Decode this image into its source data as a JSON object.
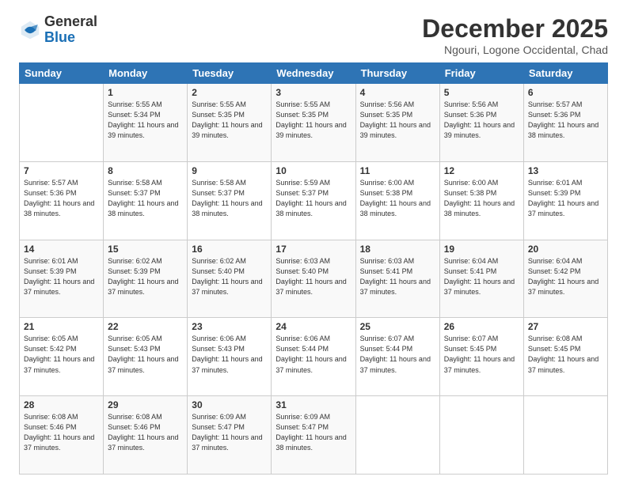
{
  "header": {
    "logo_general": "General",
    "logo_blue": "Blue",
    "main_title": "December 2025",
    "subtitle": "Ngouri, Logone Occidental, Chad"
  },
  "days_of_week": [
    "Sunday",
    "Monday",
    "Tuesday",
    "Wednesday",
    "Thursday",
    "Friday",
    "Saturday"
  ],
  "weeks": [
    [
      {
        "day": "",
        "sunrise": "",
        "sunset": "",
        "daylight": ""
      },
      {
        "day": "1",
        "sunrise": "Sunrise: 5:55 AM",
        "sunset": "Sunset: 5:34 PM",
        "daylight": "Daylight: 11 hours and 39 minutes."
      },
      {
        "day": "2",
        "sunrise": "Sunrise: 5:55 AM",
        "sunset": "Sunset: 5:35 PM",
        "daylight": "Daylight: 11 hours and 39 minutes."
      },
      {
        "day": "3",
        "sunrise": "Sunrise: 5:55 AM",
        "sunset": "Sunset: 5:35 PM",
        "daylight": "Daylight: 11 hours and 39 minutes."
      },
      {
        "day": "4",
        "sunrise": "Sunrise: 5:56 AM",
        "sunset": "Sunset: 5:35 PM",
        "daylight": "Daylight: 11 hours and 39 minutes."
      },
      {
        "day": "5",
        "sunrise": "Sunrise: 5:56 AM",
        "sunset": "Sunset: 5:36 PM",
        "daylight": "Daylight: 11 hours and 39 minutes."
      },
      {
        "day": "6",
        "sunrise": "Sunrise: 5:57 AM",
        "sunset": "Sunset: 5:36 PM",
        "daylight": "Daylight: 11 hours and 38 minutes."
      }
    ],
    [
      {
        "day": "7",
        "sunrise": "Sunrise: 5:57 AM",
        "sunset": "Sunset: 5:36 PM",
        "daylight": "Daylight: 11 hours and 38 minutes."
      },
      {
        "day": "8",
        "sunrise": "Sunrise: 5:58 AM",
        "sunset": "Sunset: 5:37 PM",
        "daylight": "Daylight: 11 hours and 38 minutes."
      },
      {
        "day": "9",
        "sunrise": "Sunrise: 5:58 AM",
        "sunset": "Sunset: 5:37 PM",
        "daylight": "Daylight: 11 hours and 38 minutes."
      },
      {
        "day": "10",
        "sunrise": "Sunrise: 5:59 AM",
        "sunset": "Sunset: 5:37 PM",
        "daylight": "Daylight: 11 hours and 38 minutes."
      },
      {
        "day": "11",
        "sunrise": "Sunrise: 6:00 AM",
        "sunset": "Sunset: 5:38 PM",
        "daylight": "Daylight: 11 hours and 38 minutes."
      },
      {
        "day": "12",
        "sunrise": "Sunrise: 6:00 AM",
        "sunset": "Sunset: 5:38 PM",
        "daylight": "Daylight: 11 hours and 38 minutes."
      },
      {
        "day": "13",
        "sunrise": "Sunrise: 6:01 AM",
        "sunset": "Sunset: 5:39 PM",
        "daylight": "Daylight: 11 hours and 37 minutes."
      }
    ],
    [
      {
        "day": "14",
        "sunrise": "Sunrise: 6:01 AM",
        "sunset": "Sunset: 5:39 PM",
        "daylight": "Daylight: 11 hours and 37 minutes."
      },
      {
        "day": "15",
        "sunrise": "Sunrise: 6:02 AM",
        "sunset": "Sunset: 5:39 PM",
        "daylight": "Daylight: 11 hours and 37 minutes."
      },
      {
        "day": "16",
        "sunrise": "Sunrise: 6:02 AM",
        "sunset": "Sunset: 5:40 PM",
        "daylight": "Daylight: 11 hours and 37 minutes."
      },
      {
        "day": "17",
        "sunrise": "Sunrise: 6:03 AM",
        "sunset": "Sunset: 5:40 PM",
        "daylight": "Daylight: 11 hours and 37 minutes."
      },
      {
        "day": "18",
        "sunrise": "Sunrise: 6:03 AM",
        "sunset": "Sunset: 5:41 PM",
        "daylight": "Daylight: 11 hours and 37 minutes."
      },
      {
        "day": "19",
        "sunrise": "Sunrise: 6:04 AM",
        "sunset": "Sunset: 5:41 PM",
        "daylight": "Daylight: 11 hours and 37 minutes."
      },
      {
        "day": "20",
        "sunrise": "Sunrise: 6:04 AM",
        "sunset": "Sunset: 5:42 PM",
        "daylight": "Daylight: 11 hours and 37 minutes."
      }
    ],
    [
      {
        "day": "21",
        "sunrise": "Sunrise: 6:05 AM",
        "sunset": "Sunset: 5:42 PM",
        "daylight": "Daylight: 11 hours and 37 minutes."
      },
      {
        "day": "22",
        "sunrise": "Sunrise: 6:05 AM",
        "sunset": "Sunset: 5:43 PM",
        "daylight": "Daylight: 11 hours and 37 minutes."
      },
      {
        "day": "23",
        "sunrise": "Sunrise: 6:06 AM",
        "sunset": "Sunset: 5:43 PM",
        "daylight": "Daylight: 11 hours and 37 minutes."
      },
      {
        "day": "24",
        "sunrise": "Sunrise: 6:06 AM",
        "sunset": "Sunset: 5:44 PM",
        "daylight": "Daylight: 11 hours and 37 minutes."
      },
      {
        "day": "25",
        "sunrise": "Sunrise: 6:07 AM",
        "sunset": "Sunset: 5:44 PM",
        "daylight": "Daylight: 11 hours and 37 minutes."
      },
      {
        "day": "26",
        "sunrise": "Sunrise: 6:07 AM",
        "sunset": "Sunset: 5:45 PM",
        "daylight": "Daylight: 11 hours and 37 minutes."
      },
      {
        "day": "27",
        "sunrise": "Sunrise: 6:08 AM",
        "sunset": "Sunset: 5:45 PM",
        "daylight": "Daylight: 11 hours and 37 minutes."
      }
    ],
    [
      {
        "day": "28",
        "sunrise": "Sunrise: 6:08 AM",
        "sunset": "Sunset: 5:46 PM",
        "daylight": "Daylight: 11 hours and 37 minutes."
      },
      {
        "day": "29",
        "sunrise": "Sunrise: 6:08 AM",
        "sunset": "Sunset: 5:46 PM",
        "daylight": "Daylight: 11 hours and 37 minutes."
      },
      {
        "day": "30",
        "sunrise": "Sunrise: 6:09 AM",
        "sunset": "Sunset: 5:47 PM",
        "daylight": "Daylight: 11 hours and 37 minutes."
      },
      {
        "day": "31",
        "sunrise": "Sunrise: 6:09 AM",
        "sunset": "Sunset: 5:47 PM",
        "daylight": "Daylight: 11 hours and 38 minutes."
      },
      {
        "day": "",
        "sunrise": "",
        "sunset": "",
        "daylight": ""
      },
      {
        "day": "",
        "sunrise": "",
        "sunset": "",
        "daylight": ""
      },
      {
        "day": "",
        "sunrise": "",
        "sunset": "",
        "daylight": ""
      }
    ]
  ]
}
